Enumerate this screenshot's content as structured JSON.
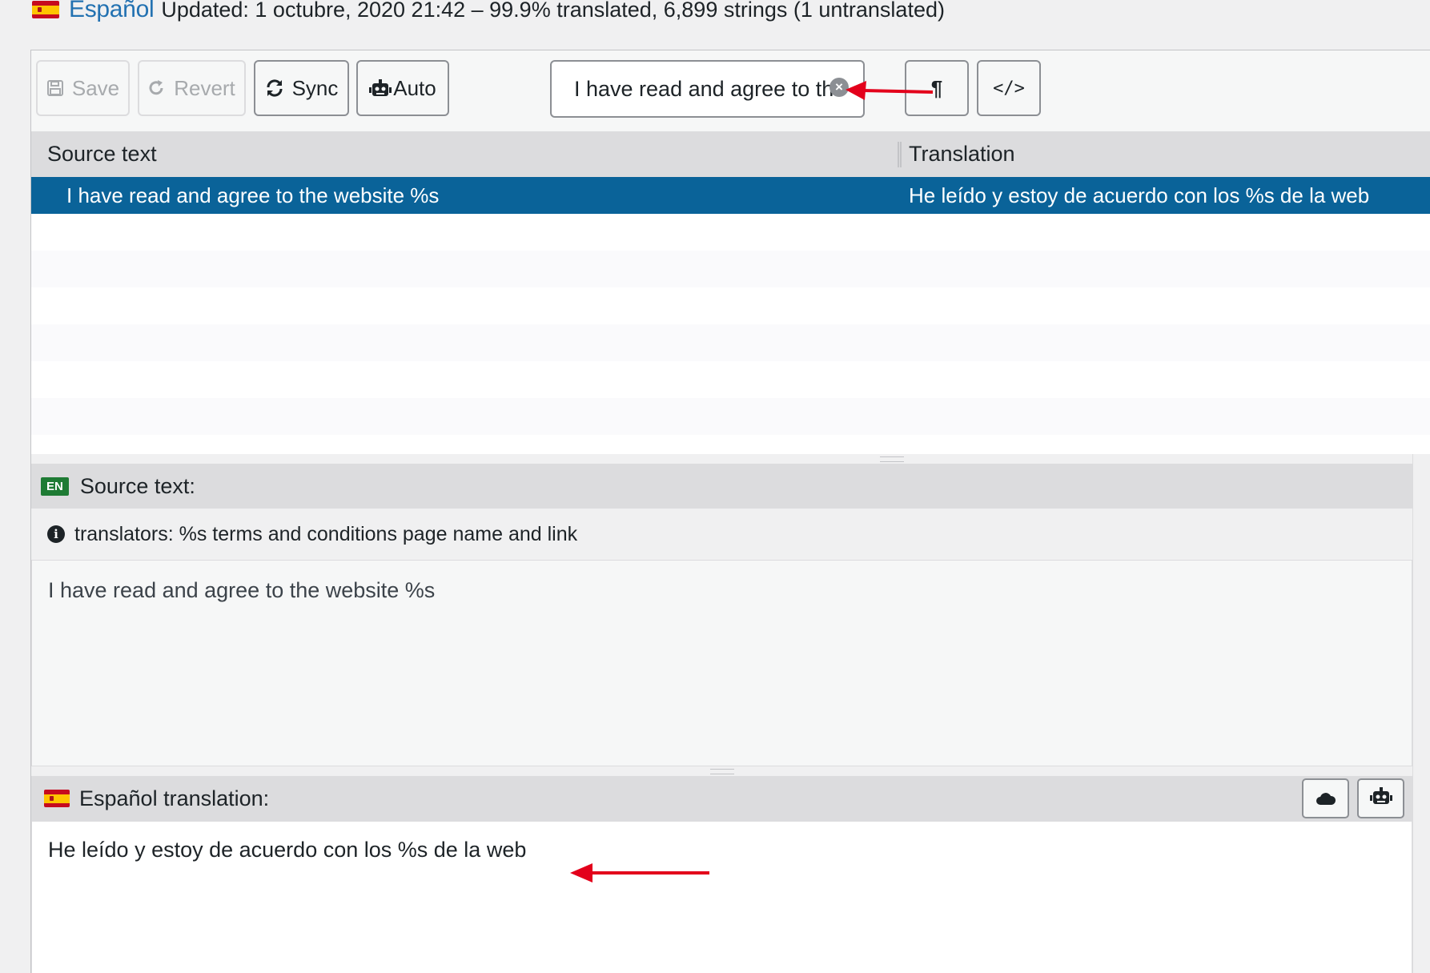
{
  "header": {
    "language": "Español",
    "meta": "Updated: 1 octubre, 2020 21:42 – 99.9% translated, 6,899 strings (1 untranslated)"
  },
  "toolbar": {
    "save_label": "Save",
    "revert_label": "Revert",
    "sync_label": "Sync",
    "auto_label": "Auto",
    "search_value": "I have read and agree to th",
    "clear_glyph": "×",
    "pilcrow_glyph": "¶",
    "code_glyph": "</>"
  },
  "list": {
    "columns": [
      "Source text",
      "Translation"
    ],
    "selected_row": {
      "source": "I have read and agree to the website %s",
      "translation": "He leído y estoy de acuerdo con los %s de la web"
    }
  },
  "source_panel": {
    "badge": "EN",
    "title": "Source text:",
    "info_glyph": "i",
    "note": "translators: %s terms and conditions page name and link",
    "text": "I have read and agree to the website %s"
  },
  "translation_panel": {
    "title": "Español translation:",
    "text": "He leído y estoy de acuerdo con los %s de la web"
  },
  "icons": {
    "save": "floppy-disk-icon",
    "revert": "undo-icon",
    "sync": "refresh-icon",
    "auto": "robot-icon",
    "cloud": "cloud-icon",
    "info": "info-icon",
    "clear": "close-circle-icon"
  },
  "colors": {
    "accent": "#2271b1",
    "selected_row": "#0a6399",
    "en_badge": "#1e7b34",
    "annotation": "#e3001b"
  }
}
